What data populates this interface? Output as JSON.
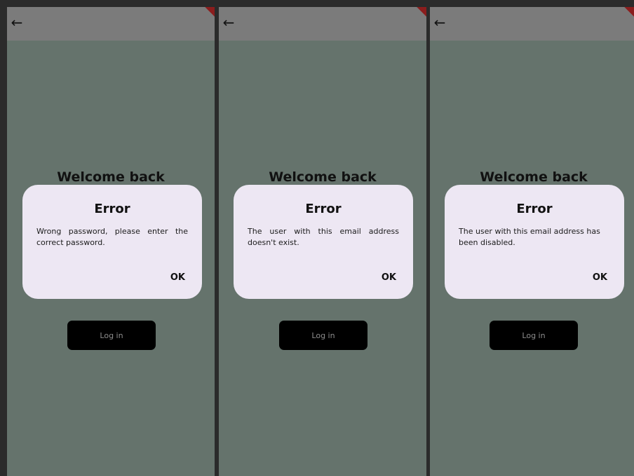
{
  "panels": [
    {
      "back_glyph": "←",
      "heading": "Welcome back",
      "dialog": {
        "title": "Error",
        "message": "Wrong password, please enter the correct password.",
        "ok_label": "OK"
      },
      "login_label": "Log in"
    },
    {
      "back_glyph": "←",
      "heading": "Welcome back",
      "dialog": {
        "title": "Error",
        "message": "The user with this email address doesn't exist.",
        "ok_label": "OK"
      },
      "login_label": "Log in"
    },
    {
      "back_glyph": "←",
      "heading": "Welcome back",
      "dialog": {
        "title": "Error",
        "message": "The user with this email address has been disabled.",
        "ok_label": "OK"
      },
      "login_label": "Log in"
    }
  ],
  "colors": {
    "scrim": "#65736c",
    "appbar": "#7b7b7b",
    "dialog": "#ede7f3",
    "button": "#000000"
  }
}
